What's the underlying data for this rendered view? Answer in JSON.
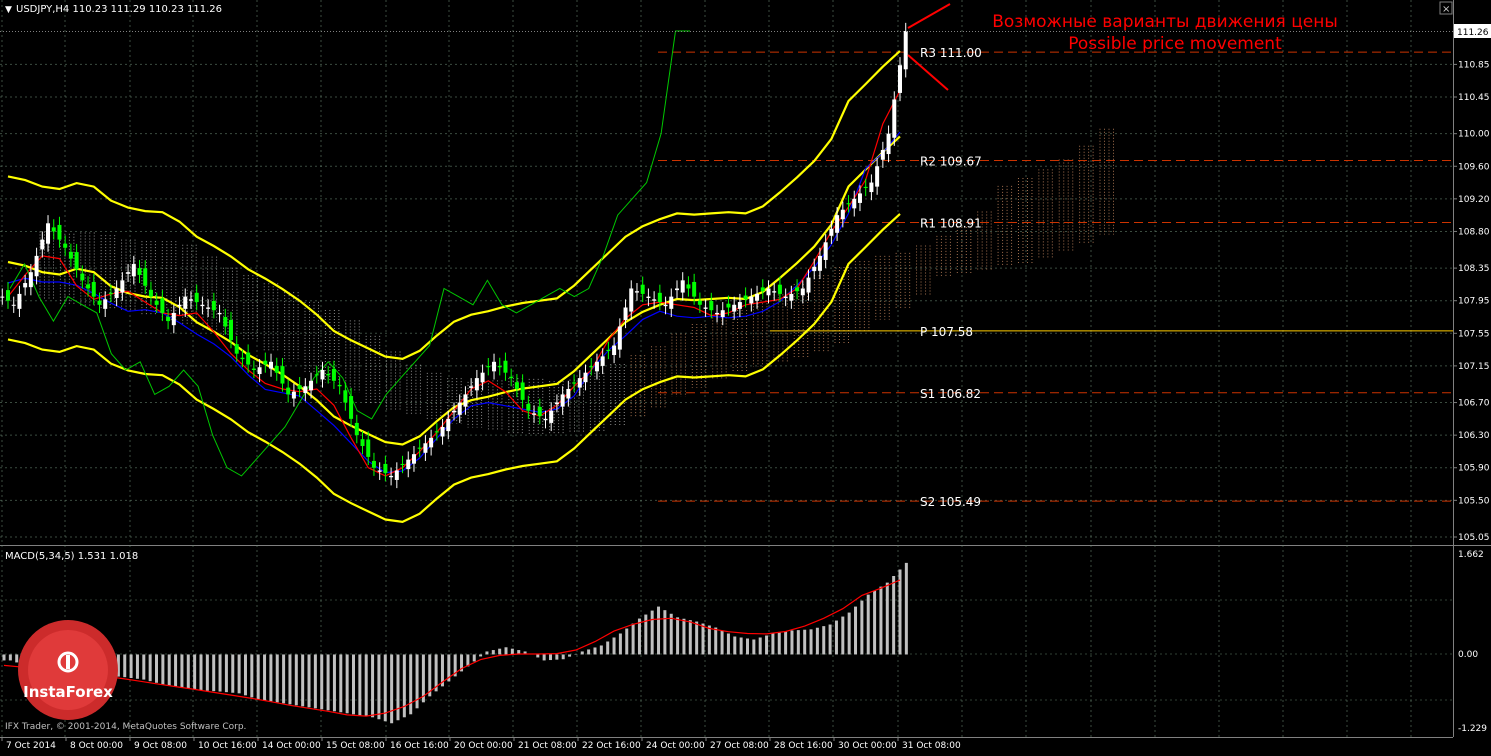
{
  "window": {
    "symbol_header": "USDJPY,H4  110.23 111.29 110.23 111.26",
    "close_button": "×"
  },
  "annotation": {
    "line1": "Возможные варианты движения цены",
    "line2": "Possible price movement"
  },
  "current_price_label": "111.26",
  "price_axis_ticks": [
    "110.85",
    "110.45",
    "110.00",
    "109.60",
    "109.20",
    "108.80",
    "108.35",
    "107.95",
    "107.55",
    "107.15",
    "106.70",
    "106.30",
    "105.90",
    "105.50",
    "105.05"
  ],
  "pivot_levels": [
    {
      "label": "R3 111.00",
      "price": 111.0
    },
    {
      "label": "R2 109.67",
      "price": 109.67
    },
    {
      "label": "R1 108.91",
      "price": 108.91
    },
    {
      "label": "P 107.58",
      "price": 107.58
    },
    {
      "label": "S1 106.82",
      "price": 106.82
    },
    {
      "label": "S2 105.49",
      "price": 105.49
    }
  ],
  "time_axis_ticks": [
    "7 Oct 2014",
    "8 Oct 00:00",
    "9 Oct 08:00",
    "10 Oct 16:00",
    "14 Oct 00:00",
    "15 Oct 08:00",
    "16 Oct 16:00",
    "20 Oct 00:00",
    "21 Oct 08:00",
    "22 Oct 16:00",
    "24 Oct 00:00",
    "27 Oct 08:00",
    "28 Oct 16:00",
    "30 Oct 00:00",
    "31 Oct 08:00"
  ],
  "macd": {
    "header": "MACD(5,34,5) 1.531 1.018",
    "axis_top": "1.662",
    "axis_zero": "0.00",
    "axis_bottom": "-1.229"
  },
  "logo": {
    "text": "InstaForex"
  },
  "copyright": "IFX Trader, © 2001-2014, MetaQuotes Software Corp.",
  "colors": {
    "background": "#000000",
    "grid": "#6b8b74",
    "bull_candle": "#ffffff",
    "bear_candle": "#00ff00",
    "bands": "#ffff00",
    "ichimoku_kijun": "#0000ff",
    "ichimoku_tenkan": "#ff0000",
    "chikou": "#00c800",
    "pivot_lines": "#cc3300",
    "annotation": "#ff0000",
    "macd_hist": "#c0c0c0",
    "macd_signal": "#ff0000"
  },
  "chart_data": {
    "type": "candlestick",
    "symbol": "USDJPY",
    "timeframe": "H4",
    "ohlc_last": {
      "open": 110.23,
      "high": 111.29,
      "low": 110.23,
      "close": 111.26
    },
    "y_range": [
      105.05,
      111.26
    ],
    "close_path": [
      107.9,
      108.3,
      108.9,
      108.6,
      108.2,
      107.9,
      108.1,
      108.4,
      108.0,
      107.7,
      108.0,
      107.9,
      107.8,
      107.3,
      107.1,
      107.2,
      106.8,
      106.9,
      107.1,
      106.9,
      106.3,
      105.9,
      105.8,
      106.0,
      106.2,
      106.4,
      106.7,
      107.0,
      107.2,
      107.0,
      106.6,
      106.5,
      106.8,
      107.0,
      107.2,
      107.4,
      108.1,
      108.0,
      107.9,
      108.2,
      107.9,
      107.8,
      107.9,
      108.0,
      108.1,
      108.0,
      108.1,
      108.5,
      109.0,
      109.2,
      109.4,
      110.0,
      111.26
    ],
    "macd_histogram": [
      -0.1,
      -0.2,
      -0.25,
      -0.3,
      -0.32,
      -0.35,
      -0.38,
      -0.42,
      -0.5,
      -0.55,
      -0.6,
      -0.62,
      -0.65,
      -0.75,
      -0.8,
      -0.85,
      -0.9,
      -0.95,
      -1.0,
      -1.05,
      -1.15,
      -1.0,
      -0.7,
      -0.45,
      -0.2,
      0.05,
      0.12,
      0.05,
      -0.1,
      -0.08,
      0.05,
      0.15,
      0.35,
      0.6,
      0.8,
      0.62,
      0.55,
      0.45,
      0.3,
      0.25,
      0.35,
      0.4,
      0.42,
      0.5,
      0.7,
      1.0,
      1.2,
      1.531
    ],
    "macd_signal": 1.018,
    "macd_range": [
      -1.229,
      1.662
    ]
  }
}
